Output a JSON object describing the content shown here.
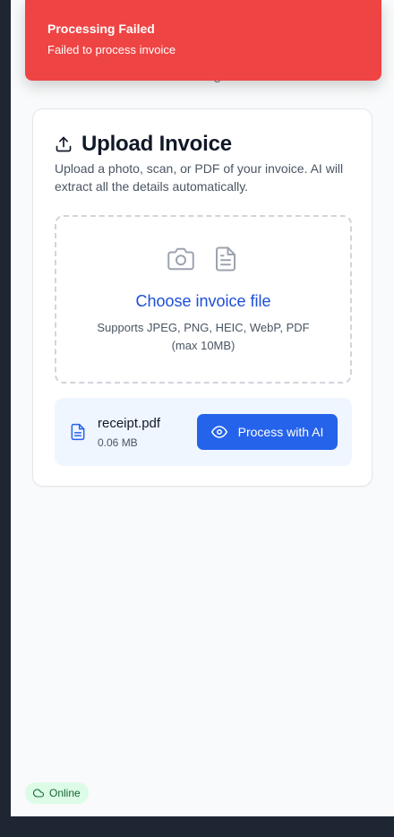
{
  "toast": {
    "title": "Processing Failed",
    "message": "Failed to process invoice",
    "color": "#ef4444"
  },
  "behind_text": "information and line items using AI",
  "upload_card": {
    "icon": "upload-icon",
    "title": "Upload Invoice",
    "description": "Upload a photo, scan, or PDF of your invoice. AI will extract all the details automatically.",
    "dropzone": {
      "icons": [
        "camera-icon",
        "document-icon"
      ],
      "title": "Choose invoice file",
      "subtitle": "Supports JPEG, PNG, HEIC, WebP, PDF (max 10MB)"
    },
    "selected_file": {
      "icon": "file-text-icon",
      "name": "receipt.pdf",
      "size": "0.06 MB",
      "process_icon": "eye-icon",
      "process_label": "Process with AI"
    }
  },
  "status": {
    "icon": "cloud-icon",
    "label": "Online",
    "color": "#166534"
  },
  "colors": {
    "accent": "#2563eb",
    "error": "#ef4444",
    "success_bg": "#dcfce7"
  }
}
